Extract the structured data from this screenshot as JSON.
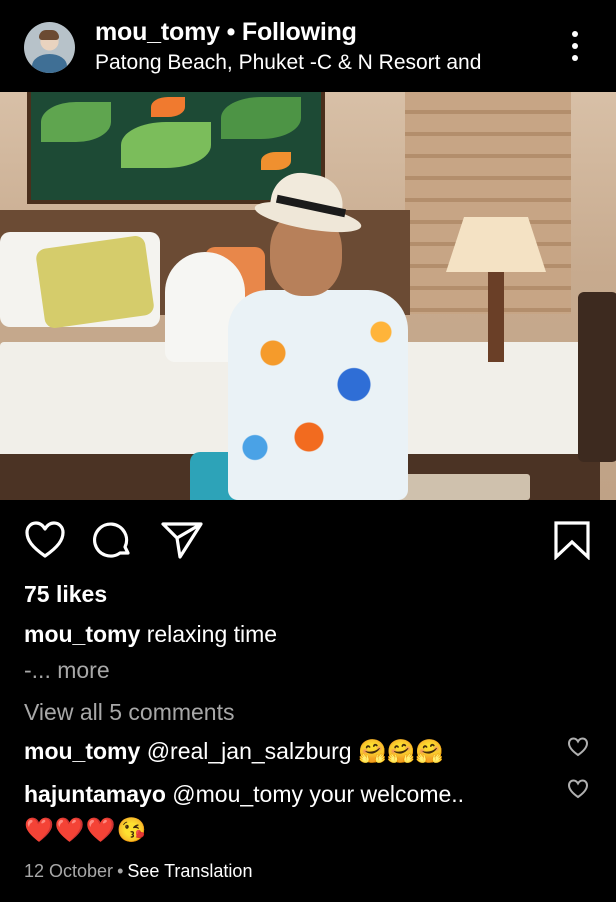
{
  "post": {
    "username": "mou_tomy",
    "separator": "•",
    "follow_status": "Following",
    "location": "Patong Beach, Phuket -C & N Resort and",
    "likes": "75 likes",
    "caption": {
      "username": "mou_tomy",
      "text": "relaxing time",
      "more": "-... more"
    },
    "view_comments": "View all 5 comments",
    "comments": [
      {
        "username": "mou_tomy",
        "text": "@real_jan_salzburg 🤗🤗🤗"
      },
      {
        "username": "hajuntamayo",
        "text": "@mou_tomy your welcome..",
        "text_line2": "❤️❤️❤️😘"
      }
    ],
    "date": "12 October",
    "meta_dot": "•",
    "translate": "See Translation"
  },
  "icons": {
    "more": "more-vertical-icon",
    "tag": "user-tag-icon",
    "like": "heart-icon",
    "comment": "comment-icon",
    "share": "send-icon",
    "save": "bookmark-icon"
  }
}
